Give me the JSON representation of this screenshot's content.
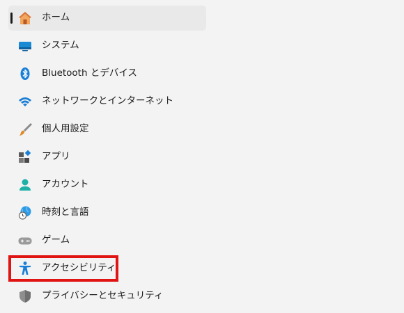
{
  "sidebar": {
    "items": [
      {
        "label": "ホーム",
        "icon": "home-icon"
      },
      {
        "label": "システム",
        "icon": "system-monitor-icon"
      },
      {
        "label": "Bluetooth とデバイス",
        "icon": "bluetooth-icon"
      },
      {
        "label": "ネットワークとインターネット",
        "icon": "wifi-icon"
      },
      {
        "label": "個人用設定",
        "icon": "brush-icon"
      },
      {
        "label": "アプリ",
        "icon": "apps-icon"
      },
      {
        "label": "アカウント",
        "icon": "person-icon"
      },
      {
        "label": "時刻と言語",
        "icon": "globe-clock-icon"
      },
      {
        "label": "ゲーム",
        "icon": "gamepad-icon"
      },
      {
        "label": "アクセシビリティ",
        "icon": "accessibility-icon"
      },
      {
        "label": "プライバシーとセキュリティ",
        "icon": "shield-icon"
      }
    ],
    "selected": "ホーム",
    "highlighted": "アクセシビリティ"
  },
  "colors": {
    "background": "#f3f3f3",
    "selected_background": "#e9e9e9",
    "highlight_border": "#e11414",
    "accent": "#0067c0"
  }
}
